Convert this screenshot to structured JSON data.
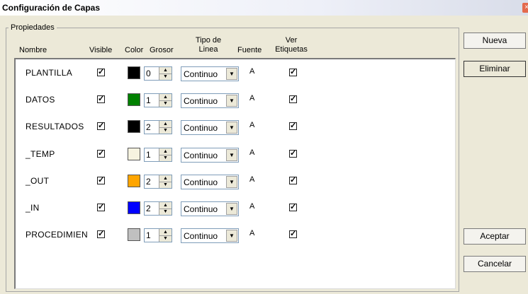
{
  "window": {
    "title": "Configuración de Capas",
    "close_glyph": "×"
  },
  "group": {
    "legend": "Propiedades"
  },
  "headers": {
    "nombre": "Nombre",
    "visible": "Visible",
    "color": "Color",
    "grosor": "Grosor",
    "tipo_line1": "Tipo de",
    "tipo_line2": "Linea",
    "fuente": "Fuente",
    "ver_line1": "Ver",
    "ver_line2": "Etiquetas"
  },
  "layers": [
    {
      "name": "PLANTILLA",
      "visible": "✓",
      "color": "#000000",
      "grosor": "0",
      "tipo": "Continuo",
      "fuente": "A",
      "ver": "✓"
    },
    {
      "name": "DATOS",
      "visible": "✓",
      "color": "#008000",
      "grosor": "1",
      "tipo": "Continuo",
      "fuente": "A",
      "ver": "✓"
    },
    {
      "name": "RESULTADOS",
      "visible": "✓",
      "color": "#000000",
      "grosor": "2",
      "tipo": "Continuo",
      "fuente": "A",
      "ver": "✓"
    },
    {
      "name": "_TEMP",
      "visible": "✓",
      "color": "#f6f3e0",
      "grosor": "1",
      "tipo": "Continuo",
      "fuente": "A",
      "ver": "✓"
    },
    {
      "name": "_OUT",
      "visible": "✓",
      "color": "#ffa500",
      "grosor": "2",
      "tipo": "Continuo",
      "fuente": "A",
      "ver": "✓"
    },
    {
      "name": "_IN",
      "visible": "✓",
      "color": "#0000ff",
      "grosor": "2",
      "tipo": "Continuo",
      "fuente": "A",
      "ver": "✓"
    },
    {
      "name": "PROCEDIMIEN",
      "visible": "✓",
      "color": "#c0c0c0",
      "grosor": "1",
      "tipo": "Continuo",
      "fuente": "A",
      "ver": "✓"
    }
  ],
  "buttons": {
    "nueva": "Nueva",
    "eliminar": "Eliminar",
    "aceptar": "Aceptar",
    "cancelar": "Cancelar"
  },
  "icons": {
    "spin_up": "▲",
    "spin_down": "▼",
    "combo_arrow": "▼"
  }
}
